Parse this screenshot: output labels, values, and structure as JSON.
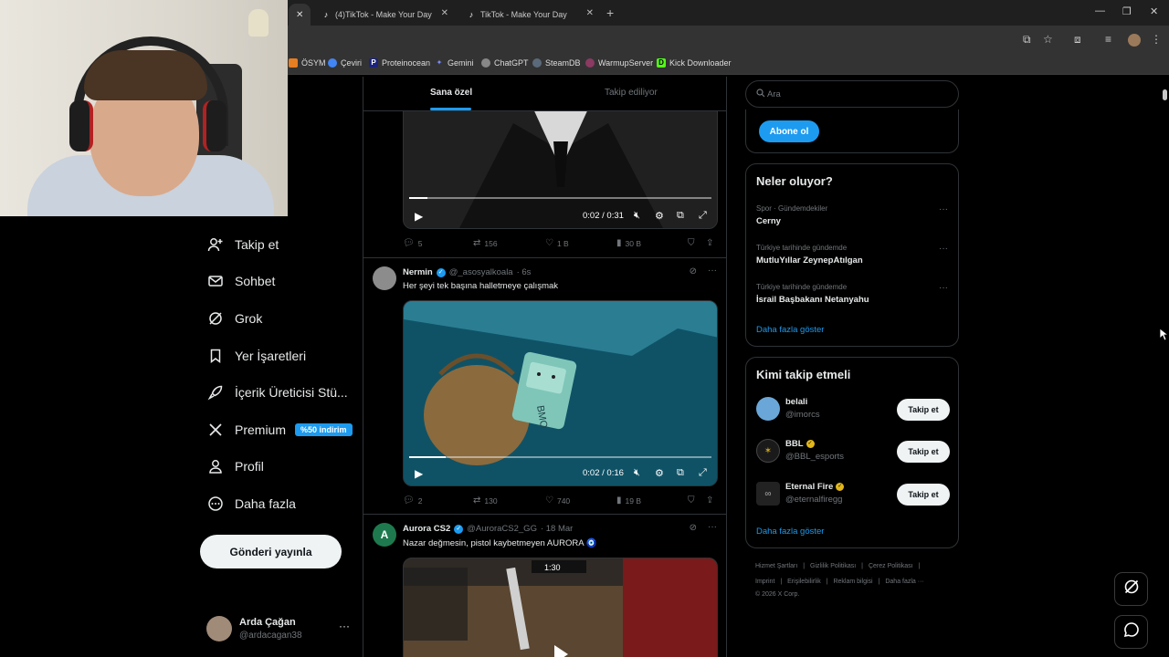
{
  "browser": {
    "tabs": [
      {
        "label": "(4)TikTok - Make Your Day"
      },
      {
        "label": "TikTok - Make Your Day"
      }
    ],
    "new_tab_symbol": "+",
    "window_controls": [
      "—",
      "❐",
      "✕"
    ]
  },
  "bookmarks": [
    {
      "label": "ÖSYM",
      "icon": "osym-icon",
      "color": "#e67e22"
    },
    {
      "label": "Çeviri",
      "icon": "translate-icon",
      "color": "#4285f4"
    },
    {
      "label": "Proteinocean",
      "icon": "P",
      "color": "#1a237e"
    },
    {
      "label": "Gemini",
      "icon": "gemini-icon",
      "color": "#7b8cff"
    },
    {
      "label": "ChatGPT",
      "icon": "chatgpt-icon",
      "color": "#888888"
    },
    {
      "label": "SteamDB",
      "icon": "steamdb-icon",
      "color": "#5a6a7a"
    },
    {
      "label": "WarmupServer",
      "icon": "warmup-icon",
      "color": "#8b3a62"
    },
    {
      "label": "Kick Downloader",
      "icon": "D",
      "color": "#53fc18"
    }
  ],
  "nav": {
    "items": [
      {
        "label": "Takip et",
        "icon": "person-add-icon"
      },
      {
        "label": "Sohbet",
        "icon": "mail-icon"
      },
      {
        "label": "Grok",
        "icon": "grok-icon"
      },
      {
        "label": "Yer İşaretleri",
        "icon": "bookmark-icon"
      },
      {
        "label": "İçerik Üreticisi Stü...",
        "icon": "rocket-icon"
      },
      {
        "label": "Premium",
        "icon": "x-logo-icon"
      },
      {
        "label": "Profil",
        "icon": "person-icon"
      },
      {
        "label": "Daha fazla",
        "icon": "more-circle-icon"
      }
    ],
    "premium_badge": "%50 indirim",
    "post_button": "Gönderi yayınla",
    "profile": {
      "name": "Arda Çağan",
      "handle": "@ardacagan38",
      "more": "···"
    }
  },
  "timeline": {
    "tabs": {
      "active": "Sana özel",
      "inactive": "Takip ediliyor"
    },
    "tweets": [
      {
        "video": {
          "time": "0:02 / 0:31",
          "progress": 0.06
        },
        "stats": {
          "replies": "5",
          "reposts": "156",
          "likes": "1 B",
          "views": "30 B"
        }
      },
      {
        "name": "Nermin",
        "handle": "@_asosyalkoala",
        "time": "· 6s",
        "text": "Her şeyi tek başına halletmeye çalışmak",
        "video": {
          "time": "0:02 / 0:16",
          "progress": 0.12
        },
        "stats": {
          "replies": "2",
          "reposts": "130",
          "likes": "740",
          "views": "19 B"
        }
      },
      {
        "name": "Aurora CS2",
        "handle": "@AuroraCS2_GG",
        "time": "· 18 Mar",
        "text": "Nazar değmesin, pistol kaybetmeyen AURORA",
        "emoji": "🧿",
        "hud_score": "1:30"
      }
    ]
  },
  "sidebar": {
    "search_placeholder": "Ara",
    "subscribe_button": "Abone ol",
    "trends_title": "Neler oluyor?",
    "trends": [
      {
        "context": "Spor · Gündemdekiler",
        "name": "Cerny"
      },
      {
        "context": "Türkiye tarihinde gündemde",
        "name": "MutluYıllar ZeynepAtılgan"
      },
      {
        "context": "Türkiye tarihinde gündemde",
        "name": "İsrail Başbakanı Netanyahu"
      }
    ],
    "show_more": "Daha fazla göster",
    "who_to_follow_title": "Kimi takip etmeli",
    "suggestions": [
      {
        "name": "belali",
        "handle": "@imorcs",
        "verified": false,
        "avatar_color": "#6aa7d8"
      },
      {
        "name": "BBL",
        "handle": "@BBL_esports",
        "verified": true,
        "avatar_color": "#1a1a1a"
      },
      {
        "name": "Eternal Fire",
        "handle": "@eternalfiregg",
        "verified": true,
        "avatar_color": "#222222"
      }
    ],
    "follow_button": "Takip et",
    "show_more_2": "Daha fazla göster",
    "footer": {
      "line1": [
        "Hizmet Şartları",
        "|",
        "Gizlilik Politikası",
        "|",
        "Çerez Politikası",
        "|"
      ],
      "line2": [
        "Imprint",
        "|",
        "Erişilebilirlik",
        "|",
        "Reklam bilgisi",
        "|",
        "Daha fazla ···"
      ],
      "copyright": "© 2026 X Corp."
    }
  },
  "colors": {
    "accent": "#1d9bf0",
    "background": "#000000",
    "border": "#2f3336",
    "muted": "#71767b"
  }
}
